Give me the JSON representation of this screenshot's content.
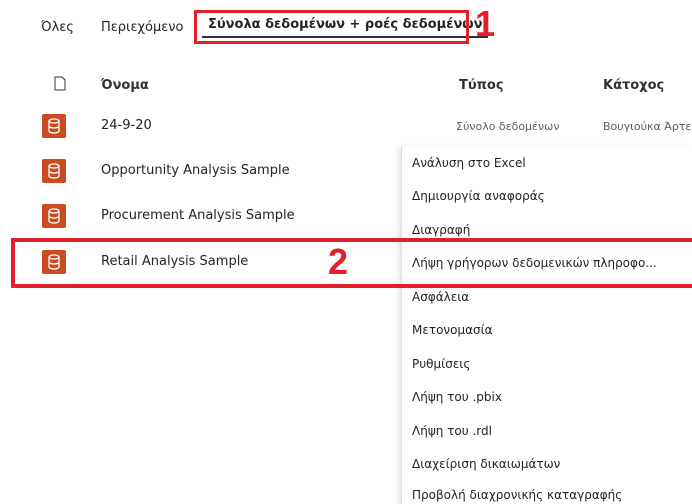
{
  "tabs": {
    "all": "Όλες",
    "content": "Περιεχόμενο",
    "datasets": "Σύνολα δεδομένων + ροές δεδομένων"
  },
  "callouts": {
    "one": "1",
    "two": "2"
  },
  "columns": {
    "name": "Όνομα",
    "type": "Τύπος",
    "owner": "Κάτοχος"
  },
  "rows": [
    {
      "name": "24-9-20",
      "type": "Σύνολο δεδομένων",
      "owner": "Βουγιούκα Άρτεμις"
    },
    {
      "name": "Opportunity Analysis Sample"
    },
    {
      "name": "Procurement Analysis Sample"
    },
    {
      "name": "Retail Analysis Sample"
    }
  ],
  "menu": [
    "Ανάλυση στο Excel",
    "Δημιουργία αναφοράς",
    "Διαγραφή",
    "Λήψη γρήγορων δεδομενικών πληροφο...",
    "Ασφάλεια",
    "Μετονομασία",
    "Ρυθμίσεις",
    "Λήψη του .pbix",
    "Λήψη του .rdl",
    "Διαχείριση δικαιωμάτων",
    "Προβολή διαχρονικής καταγραφής"
  ],
  "colors": {
    "accent": "#e3202a",
    "dataset_icon": "#cb4b20"
  },
  "icons": {
    "header": "document-icon",
    "row": "database-icon"
  }
}
